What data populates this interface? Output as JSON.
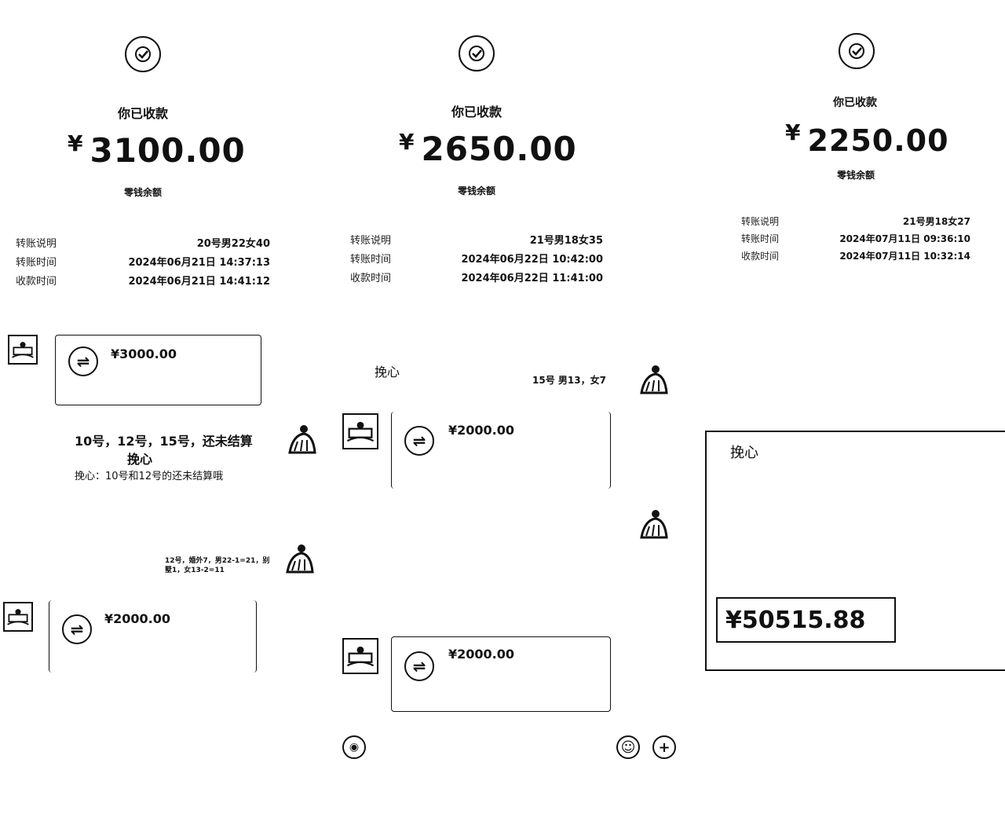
{
  "receipts": [
    {
      "status": "你已收款",
      "currency": "¥",
      "amount": "3100.00",
      "balance_label": "零钱余额",
      "rows": [
        {
          "label": "转账说明",
          "value": "20号男22女40"
        },
        {
          "label": "转账时间",
          "value": "2024年06月21日 14:37:13"
        },
        {
          "label": "收款时间",
          "value": "2024年06月21日 14:41:12"
        }
      ]
    },
    {
      "status": "你已收款",
      "currency": "¥",
      "amount": "2650.00",
      "balance_label": "零钱余额",
      "rows": [
        {
          "label": "转账说明",
          "value": "21号男18女35"
        },
        {
          "label": "转账时间",
          "value": "2024年06月22日 10:42:00"
        },
        {
          "label": "收款时间",
          "value": "2024年06月22日 11:41:00"
        }
      ]
    },
    {
      "status": "你已收款",
      "currency": "¥",
      "amount": "2250.00",
      "balance_label": "零钱余额",
      "rows": [
        {
          "label": "转账说明",
          "value": "21号男18女27"
        },
        {
          "label": "转账时间",
          "value": "2024年07月11日 09:36:10"
        },
        {
          "label": "收款时间",
          "value": "2024年07月11日 10:32:14"
        }
      ]
    }
  ],
  "chat_left": {
    "bubble1_amount": "¥3000.00",
    "msg_unsettled": "10号，12号，15号，还未结算",
    "sender_name": "挽心",
    "quote": "挽心：10号和12号的还未结算哦",
    "note_line1": "12号，婚外7，男22-1=21，别",
    "note_line2": "墅1，女13-2=11",
    "bubble2_amount": "¥2000.00"
  },
  "chat_mid": {
    "sender_name": "挽心",
    "msg_15": "15号 男13，女7",
    "bubble1_amount": "¥2000.00",
    "bubble2_amount": "¥2000.00"
  },
  "panel_right": {
    "title": "挽心",
    "total": "¥50515.88"
  },
  "colors": {
    "ink": "#111111",
    "background": "#ffffff"
  },
  "icons": [
    "check-icon",
    "transfer-icon",
    "voice-icon",
    "emoji-icon",
    "plus-icon",
    "avatar-icon"
  ]
}
